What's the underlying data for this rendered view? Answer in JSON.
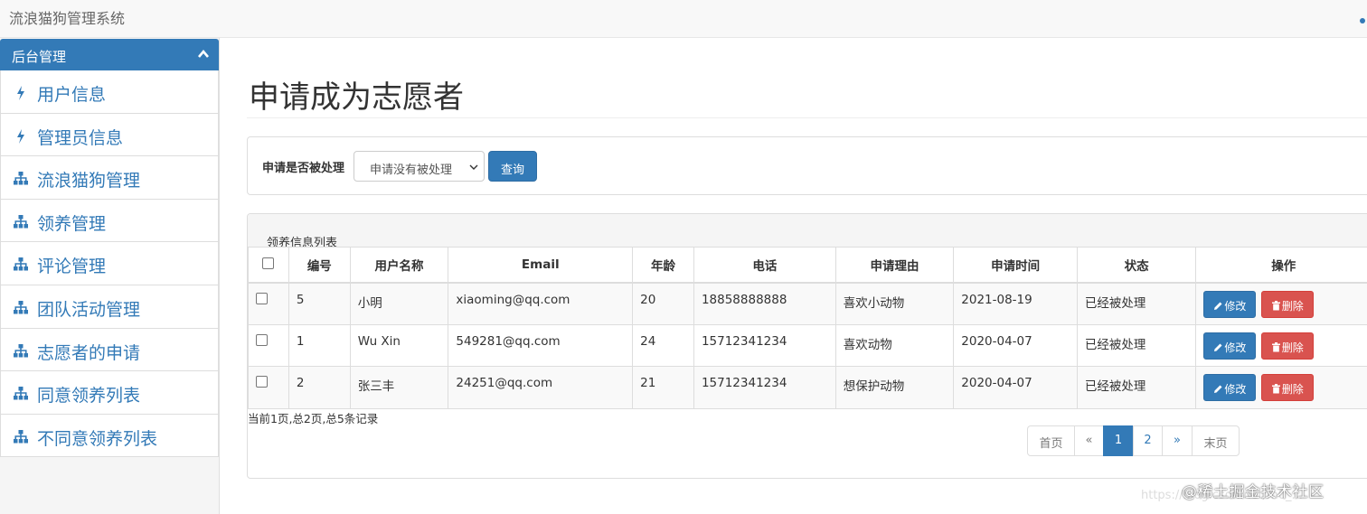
{
  "app": {
    "title": "流浪猫狗管理系统"
  },
  "sidebar": {
    "header": "后台管理",
    "items": [
      {
        "label": "用户信息",
        "icon": "bolt-icon"
      },
      {
        "label": "管理员信息",
        "icon": "bolt-icon"
      },
      {
        "label": "流浪猫狗管理",
        "icon": "sitemap-icon"
      },
      {
        "label": "领养管理",
        "icon": "sitemap-icon"
      },
      {
        "label": "评论管理",
        "icon": "sitemap-icon"
      },
      {
        "label": "团队活动管理",
        "icon": "sitemap-icon"
      },
      {
        "label": "志愿者的申请",
        "icon": "sitemap-icon"
      },
      {
        "label": "同意领养列表",
        "icon": "sitemap-icon"
      },
      {
        "label": "不同意领养列表",
        "icon": "sitemap-icon"
      }
    ]
  },
  "main": {
    "page_title": "申请成为志愿者",
    "filter": {
      "label": "申请是否被处理",
      "selected": "申请没有被处理",
      "query_button": "查询"
    },
    "list": {
      "title": "领养信息列表",
      "columns": [
        "编号",
        "用户名称",
        "Email",
        "年龄",
        "电话",
        "申请理由",
        "申请时间",
        "状态",
        "操作"
      ],
      "rows": [
        {
          "id": "5",
          "name": "小明",
          "email": "xiaoming@qq.com",
          "age": "20",
          "phone": "18858888888",
          "reason": "喜欢小动物",
          "date": "2021-08-19",
          "status": "已经被处理"
        },
        {
          "id": "1",
          "name": "Wu Xin",
          "email": "549281@qq.com",
          "age": "24",
          "phone": "15712341234",
          "reason": "喜欢动物",
          "date": "2020-04-07",
          "status": "已经被处理"
        },
        {
          "id": "2",
          "name": "张三丰",
          "email": "24251@qq.com",
          "age": "21",
          "phone": "15712341234",
          "reason": "想保护动物",
          "date": "2020-04-07",
          "status": "已经被处理"
        }
      ],
      "edit_label": "修改",
      "delete_label": "删除"
    },
    "record_info": "当前1页,总2页,总5条记录",
    "pagination": {
      "first": "首页",
      "prev": "«",
      "pages": [
        "1",
        "2"
      ],
      "current": "1",
      "next": "»",
      "last": "末页"
    }
  },
  "watermark": {
    "text": "@稀土掘金技术社区",
    "url": "https://blog.csdn.net/m0_..."
  },
  "colors": {
    "primary": "#337ab7",
    "danger": "#d9534f",
    "topbar": "#f8f8f8"
  }
}
